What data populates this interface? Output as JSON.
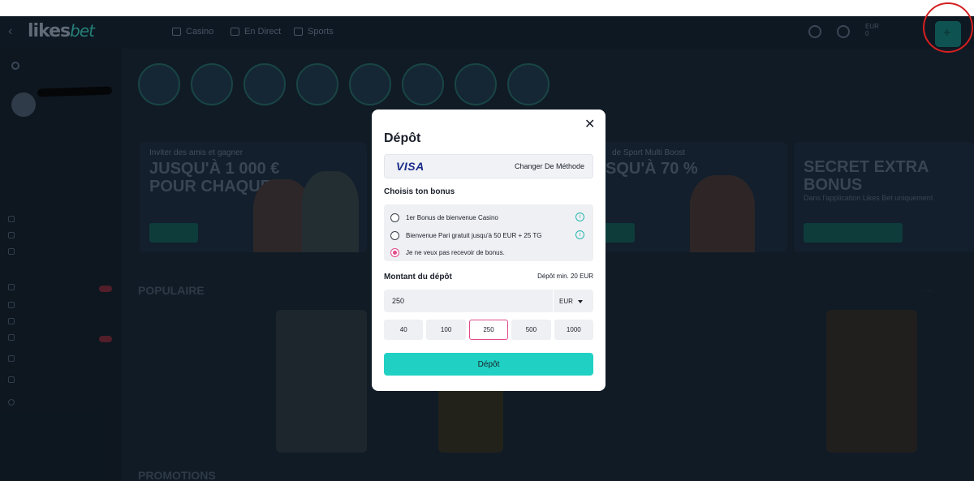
{
  "app": {
    "logo": "likes",
    "logo_suffix": "bet",
    "nav_tabs": [
      "Casino",
      "En Direct",
      "Sports"
    ],
    "balance_line1": "EUR",
    "balance_line2": "0"
  },
  "banners": [
    {
      "small": "Inviter des amis et gagner",
      "big_line1": "JUSQU'À 1 000 €",
      "big_line2": "POUR CHAQUE"
    },
    {
      "small": "de Sport Multi Boost",
      "big_line1": "SQU'À 70 %",
      "big_line2": ""
    },
    {
      "small": "",
      "big_line1": "SECRET EXTRA",
      "big_line2": "BONUS",
      "sub": "Dans l'application Likes Bet uniquement"
    }
  ],
  "sections": {
    "popular": "POPULAIRE",
    "promotions": "PROMOTIONS"
  },
  "modal": {
    "title": "Dépôt",
    "close_icon": "close-icon",
    "payment_method": "VISA",
    "change_method": "Changer De Méthode",
    "bonus_label": "Choisis ton bonus",
    "bonus_options": [
      {
        "label": "1er Bonus de bienvenue Casino",
        "selected": false,
        "info": true
      },
      {
        "label": "Bienvenue Pari gratuit jusqu'à 50 EUR + 25 TG",
        "selected": false,
        "info": true
      },
      {
        "label": "Je ne veux pas recevoir de bonus.",
        "selected": true,
        "info": false
      }
    ],
    "amount_label": "Montant du dépôt",
    "min_deposit": "Dépôt min. 20 EUR",
    "amount_value": "250",
    "currency": "EUR",
    "quick_amounts": [
      "40",
      "100",
      "250",
      "500",
      "1000"
    ],
    "selected_quick_amount": "250",
    "submit_label": "Dépôt"
  },
  "colors": {
    "accent": "#20d1c3",
    "selection": "#e24a8d",
    "highlight_circle": "#d42020"
  }
}
